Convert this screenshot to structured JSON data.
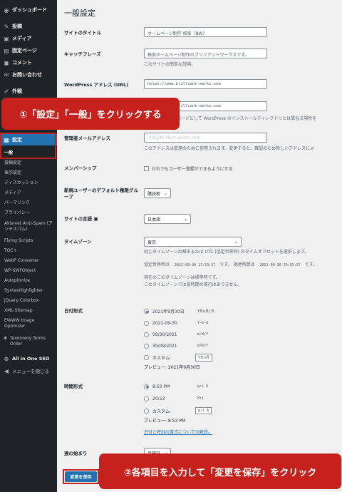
{
  "sidebar": {
    "items": [
      {
        "icon": "dashboard-icon",
        "glyph": "◉",
        "label": "ダッシュボード"
      },
      {
        "icon": "pin-icon",
        "glyph": "✎",
        "label": "投稿"
      },
      {
        "icon": "media-icon",
        "glyph": "▣",
        "label": "メディア"
      },
      {
        "icon": "page-icon",
        "glyph": "▤",
        "label": "固定ページ"
      },
      {
        "icon": "comment-icon",
        "glyph": "◼",
        "label": "コメント"
      },
      {
        "icon": "mail-icon",
        "glyph": "✉",
        "label": "お問い合わせ"
      },
      {
        "icon": "appearance-icon",
        "glyph": "✐",
        "label": "外観"
      }
    ],
    "settings": {
      "icon": "settings-icon",
      "glyph": "▦",
      "label": "設定"
    },
    "submenu": [
      "一般",
      "投稿設定",
      "表示設定",
      "ディスカッション",
      "メディア",
      "パーマリンク",
      "プライバシー",
      "Akismet Anti-Spam (アンチスパム)",
      "Flying Scripts",
      "TOC+",
      "WebP Converter",
      "WP-SWFObject",
      "Autoptimize",
      "SyntaxHighlighter",
      "jQuery Colorbox",
      "XML-Sitemap",
      "EWWW Image Optimizer",
      "Taxonomy Terms Order"
    ],
    "all_in_one": "All in One SEO",
    "collapse": "メニューを閉じる"
  },
  "page": {
    "title": "一般設定",
    "site_title_label": "サイトのタイトル",
    "site_title_value": "ホームページ制作 岐阜（BW）",
    "tagline_label": "キャッチフレーズ",
    "tagline_value": "格安ホームページ制作のブリリアントワークスです。",
    "tagline_desc": "このサイトの簡単な説明。",
    "wp_address_label": "WordPress アドレス (URL)",
    "wp_address_value": "https://www.brilliant-works.com",
    "site_address_value": "https://www.brilliant-works.com",
    "site_address_desc_pre": "ページとして WordPress のインストールディレクトリとは異なる場所を",
    "admin_email_label": "管理者メールアドレス",
    "admin_email_value": "info@brilliant-works.com",
    "admin_email_desc": "このアドレスは管理のために使用されます。変更すると、確認のため新しいアドレスにメ",
    "membership_label": "メンバーシップ",
    "membership_text": "だれでもユーザー登録ができるようにする",
    "default_role_label": "新規ユーザーのデフォルト権限グループ",
    "default_role_value": "購読者",
    "site_language_label": "サイトの言語",
    "site_language_value": "日本語",
    "timezone_label": "タイムゾーン",
    "timezone_value": "東京",
    "timezone_desc": "同じタイムゾーンの都市または UTC (協定世界時) のタイムオフセットを選択します。",
    "utc_label": "協定世界時は",
    "utc_value": "2021-09-30 11:53:57",
    "utc_mid": "です。 現地時間は",
    "local_value": "2021-09-30 20:53:57",
    "local_end": "です。",
    "dst_1": "現在のこのタイムゾーンは標準時です。",
    "dst_2": "このタイムゾーンでは夏時間の慣行はありません。",
    "date_format_label": "日付形式",
    "date_formats": [
      {
        "text": "2021年9月30日",
        "code": "Y年n月j日",
        "on": true
      },
      {
        "text": "2021-09-30",
        "code": "Y-m-d",
        "on": false
      },
      {
        "text": "09/30/2021",
        "code": "m/d/Y",
        "on": false
      },
      {
        "text": "30/09/2021",
        "code": "d/m/Y",
        "on": false
      },
      {
        "text": "カスタム:",
        "code": "Y年n月",
        "on": false
      }
    ],
    "date_preview": "プレビュー: 2021年9月30日",
    "time_format_label": "時間形式",
    "time_formats": [
      {
        "text": "8:53 PM",
        "code": "g:i A",
        "on": true
      },
      {
        "text": "20:53",
        "code": "H:i",
        "on": false
      },
      {
        "text": "カスタム:",
        "code": "g:i A",
        "on": false
      }
    ],
    "time_preview": "プレビュー: 8:53 PM",
    "date_doc_link": "日付と時刻の書式についての解説。",
    "week_start_label": "週の始まり",
    "week_start_value": "月曜日",
    "save_button": "変更を保存"
  },
  "callouts": {
    "one": "①「設定」「一般」をクリックする",
    "two": "②各項目を入力して「変更を保存」をクリック"
  },
  "colors": {
    "callout": "#c6211d",
    "sidebar": "#1d2327",
    "accent": "#2271b1"
  }
}
